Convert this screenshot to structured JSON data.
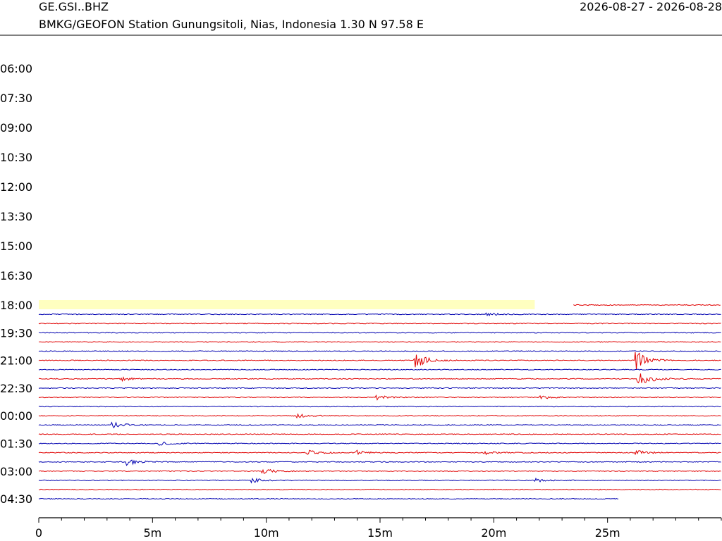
{
  "header": {
    "station": "GE.GSI..BHZ",
    "description": "BMKG/GEOFON Station Gunungsitoli, Nias, Indonesia  1.30 N 97.58 E",
    "date_range": "2026-08-27 - 2026-08-28"
  },
  "colors": {
    "trace_a": "#e00000",
    "trace_b": "#0000b0",
    "highlight": "#ffffc0",
    "axis": "#000000"
  },
  "chart_data": {
    "type": "line",
    "title": "GE.GSI..BHZ",
    "subtitle": "BMKG/GEOFON Station Gunungsitoli, Nias, Indonesia  1.30 N 97.58 E",
    "xlabel": "",
    "ylabel": "",
    "x_ticks": [
      "0",
      "5m",
      "10m",
      "15m",
      "20m",
      "25m"
    ],
    "x_tick_values": [
      0,
      5,
      10,
      15,
      20,
      25
    ],
    "xlim": [
      0,
      30
    ],
    "x_minor_step": 1,
    "y_labels": [
      "06:00",
      "07:30",
      "09:00",
      "10:30",
      "12:00",
      "13:30",
      "15:00",
      "16:30",
      "18:00",
      "19:30",
      "21:00",
      "22:30",
      "00:00",
      "01:30",
      "03:00",
      "04:30"
    ],
    "empty_rows_before_data": 8,
    "highlight_first_row": {
      "start_min": 0,
      "end_min": 21.8
    },
    "trace_rows": [
      {
        "label": "18:00",
        "color": "red",
        "start_min": 23.5,
        "end_min": 30,
        "events": []
      },
      {
        "label": "",
        "color": "blue",
        "start_min": 0,
        "end_min": 30,
        "events": [
          {
            "t_min": 19.6,
            "amp": 0.2
          }
        ]
      },
      {
        "label": "",
        "color": "red",
        "start_min": 0,
        "end_min": 30,
        "events": []
      },
      {
        "label": "19:30",
        "color": "blue",
        "start_min": 0,
        "end_min": 30,
        "events": []
      },
      {
        "label": "",
        "color": "red",
        "start_min": 0,
        "end_min": 30,
        "events": []
      },
      {
        "label": "",
        "color": "blue",
        "start_min": 0,
        "end_min": 30,
        "events": []
      },
      {
        "label": "21:00",
        "color": "red",
        "start_min": 0,
        "end_min": 30,
        "events": [
          {
            "t_min": 16.5,
            "amp": 1.0
          },
          {
            "t_min": 26.2,
            "amp": 1.3
          }
        ]
      },
      {
        "label": "",
        "color": "blue",
        "start_min": 0,
        "end_min": 30,
        "events": []
      },
      {
        "label": "",
        "color": "red",
        "start_min": 0,
        "end_min": 30,
        "events": [
          {
            "t_min": 3.5,
            "amp": 0.3
          },
          {
            "t_min": 26.3,
            "amp": 1.3
          }
        ]
      },
      {
        "label": "22:30",
        "color": "blue",
        "start_min": 0,
        "end_min": 30,
        "events": []
      },
      {
        "label": "",
        "color": "red",
        "start_min": 0,
        "end_min": 30,
        "events": [
          {
            "t_min": 14.8,
            "amp": 0.3
          },
          {
            "t_min": 22.0,
            "amp": 0.25
          }
        ]
      },
      {
        "label": "",
        "color": "blue",
        "start_min": 0,
        "end_min": 30,
        "events": []
      },
      {
        "label": "00:00",
        "color": "red",
        "start_min": 0,
        "end_min": 30,
        "events": [
          {
            "t_min": 11.3,
            "amp": 0.3
          }
        ]
      },
      {
        "label": "",
        "color": "blue",
        "start_min": 0,
        "end_min": 30,
        "events": [
          {
            "t_min": 3.2,
            "amp": 0.35
          }
        ]
      },
      {
        "label": "",
        "color": "red",
        "start_min": 0,
        "end_min": 30,
        "events": []
      },
      {
        "label": "01:30",
        "color": "blue",
        "start_min": 0,
        "end_min": 30,
        "events": [
          {
            "t_min": 5.2,
            "amp": 0.25
          }
        ]
      },
      {
        "label": "",
        "color": "red",
        "start_min": 0,
        "end_min": 30,
        "events": [
          {
            "t_min": 11.8,
            "amp": 0.3
          },
          {
            "t_min": 13.9,
            "amp": 0.3
          },
          {
            "t_min": 19.5,
            "amp": 0.25
          },
          {
            "t_min": 26.2,
            "amp": 0.3
          }
        ]
      },
      {
        "label": "",
        "color": "blue",
        "start_min": 0,
        "end_min": 30,
        "events": [
          {
            "t_min": 3.8,
            "amp": 0.45
          }
        ]
      },
      {
        "label": "03:00",
        "color": "red",
        "start_min": 0,
        "end_min": 30,
        "events": [
          {
            "t_min": 9.8,
            "amp": 0.35
          }
        ]
      },
      {
        "label": "",
        "color": "blue",
        "start_min": 0,
        "end_min": 30,
        "events": [
          {
            "t_min": 9.3,
            "amp": 0.35
          },
          {
            "t_min": 21.8,
            "amp": 0.2
          }
        ]
      },
      {
        "label": "",
        "color": "red",
        "start_min": 0,
        "end_min": 30,
        "events": []
      },
      {
        "label": "04:30",
        "color": "blue",
        "start_min": 0,
        "end_min": 25.5,
        "events": []
      }
    ]
  }
}
